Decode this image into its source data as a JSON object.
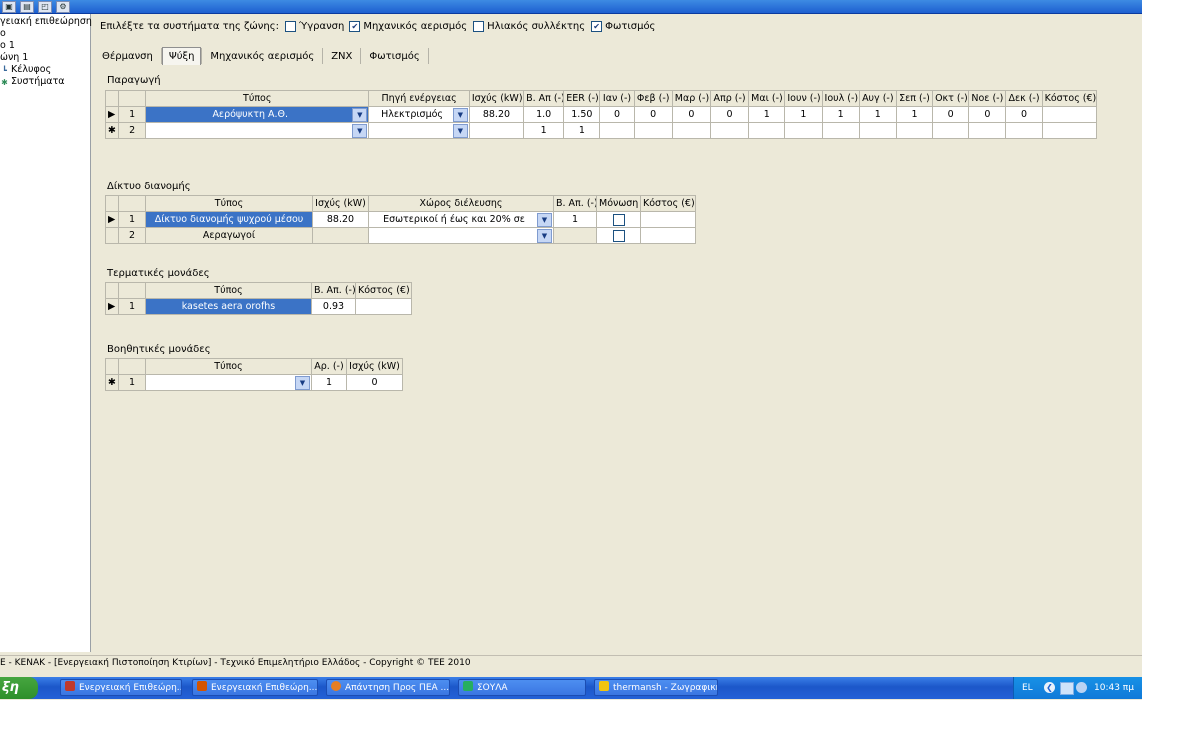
{
  "toolbar": {
    "icons": [
      "open-icon",
      "save-icon",
      "preview-icon",
      "settings-icon"
    ]
  },
  "tree": {
    "items": [
      {
        "label": "γειακή επιθεώρηση"
      },
      {
        "label": "ο"
      },
      {
        "label": "ο 1"
      },
      {
        "label": "ώνη 1"
      },
      {
        "label": "Κέλυφος"
      },
      {
        "label": "Συστήματα"
      }
    ]
  },
  "zone_selector": {
    "label": "Επιλέξτε τα συστήματα της ζώνης:",
    "options": [
      {
        "label": "Ύγρανση",
        "checked": false
      },
      {
        "label": "Μηχανικός αερισμός",
        "checked": true
      },
      {
        "label": "Ηλιακός συλλέκτης",
        "checked": false
      },
      {
        "label": "Φωτισμός",
        "checked": true
      }
    ]
  },
  "tabs": [
    "Θέρμανση",
    "Ψύξη",
    "Μηχανικός αερισμός",
    "ΖΝΧ",
    "Φωτισμός"
  ],
  "active_tab": "Ψύξη",
  "production": {
    "title": "Παραγωγή",
    "columns": [
      "Τύπος",
      "Πηγή ενέργειας",
      "Ισχύς (kW)",
      "Β. Απ (-)",
      "EER (-)",
      "Ιαν (-)",
      "Φεβ (-)",
      "Μαρ (-)",
      "Απρ (-)",
      "Μαι (-)",
      "Ιουν (-)",
      "Ιουλ (-)",
      "Αυγ (-)",
      "Σεπ (-)",
      "Οκτ (-)",
      "Νοε (-)",
      "Δεκ (-)",
      "Κόστος (€)"
    ],
    "rows": [
      {
        "marker": "▶",
        "num": "1",
        "type": "Αερόψυκτη Α.Θ.",
        "source": "Ηλεκτρισμός",
        "power": "88.20",
        "ba": "1.0",
        "eer": "1.50",
        "months": [
          "0",
          "0",
          "0",
          "0",
          "1",
          "1",
          "1",
          "1",
          "1",
          "0",
          "0",
          "0"
        ],
        "cost": ""
      },
      {
        "marker": "✱",
        "num": "2",
        "type": "",
        "source": "",
        "power": "",
        "ba": "1",
        "eer": "1",
        "months": [
          "",
          "",
          "",
          "",
          "",
          "",
          "",
          "",
          "",
          "",
          "",
          ""
        ],
        "cost": ""
      }
    ]
  },
  "distribution": {
    "title": "Δίκτυο διανομής",
    "columns": [
      "Τύπος",
      "Ισχύς (kW)",
      "Χώρος διέλευσης",
      "Β. Απ. (-)",
      "Μόνωση",
      "Κόστος (€)"
    ],
    "rows": [
      {
        "marker": "▶",
        "num": "1",
        "type": "Δίκτυο διανομής ψυχρού μέσου",
        "power": "88.20",
        "space": "Εσωτερικοί  ή έως και 20% σε",
        "ba": "1",
        "insulation": false,
        "cost": ""
      },
      {
        "marker": "",
        "num": "2",
        "type": "Αεραγωγοί",
        "power": "",
        "space": "",
        "ba": "",
        "insulation": false,
        "cost": ""
      }
    ]
  },
  "terminal": {
    "title": "Τερματικές μονάδες",
    "columns": [
      "Τύπος",
      "Β. Απ. (-)",
      "Κόστος (€)"
    ],
    "rows": [
      {
        "marker": "▶",
        "num": "1",
        "type": "kasetes aera orofhs",
        "ba": "0.93",
        "cost": ""
      }
    ]
  },
  "auxiliary": {
    "title": "Βοηθητικές μονάδες",
    "columns": [
      "Τύπος",
      "Αρ. (-)",
      "Ισχύς (kW)"
    ],
    "rows": [
      {
        "marker": "✱",
        "num": "1",
        "type": "",
        "count": "1",
        "power": "0"
      }
    ]
  },
  "statusbar": {
    "text": "Ε - KENAK - [Ενεργειακή Πιστοποίηση Κτιρίων] - Τεχνικό Επιμελητήριο Ελλάδος - Copyright © TEE 2010"
  },
  "taskbar": {
    "start": "ξη",
    "tasks": [
      {
        "label": "Ενεργειακή Επιθεώρη...",
        "icon_color": "#c0392b"
      },
      {
        "label": "Ενεργειακή Επιθεώρη...",
        "icon_color": "#d35400"
      },
      {
        "label": "Απάντηση Προς ΠΕΑ ...",
        "icon_color": "#e67e22"
      },
      {
        "label": "ΣΟΥΛΑ",
        "icon_color": "#27ae60"
      },
      {
        "label": "thermansh - Ζωγραφική",
        "icon_color": "#f1c40f"
      }
    ],
    "lang": "EL",
    "time": "10:43 πμ"
  }
}
